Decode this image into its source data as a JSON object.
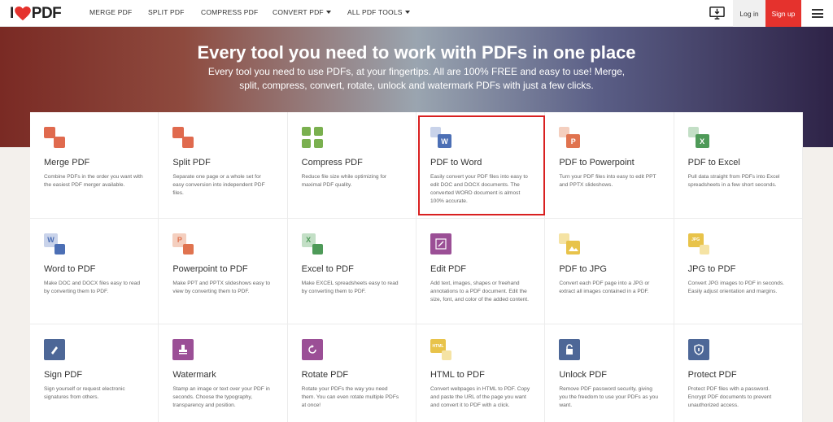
{
  "brand": {
    "logo_i": "I",
    "logo_pdf": "PDF",
    "accent": "#e5322d"
  },
  "nav": {
    "links": [
      {
        "label": "MERGE PDF",
        "dropdown": false
      },
      {
        "label": "SPLIT PDF",
        "dropdown": false
      },
      {
        "label": "COMPRESS PDF",
        "dropdown": false
      },
      {
        "label": "CONVERT PDF",
        "dropdown": true
      },
      {
        "label": "ALL PDF TOOLS",
        "dropdown": true
      }
    ],
    "login": "Log in",
    "signup": "Sign up"
  },
  "hero": {
    "title": "Every tool you need to work with PDFs in one place",
    "subtitle": "Every tool you need to use PDFs, at your fingertips. All are 100% FREE and easy to use! Merge, split, compress, convert, rotate, unlock and watermark PDFs with just a few clicks."
  },
  "tools": [
    {
      "name": "Merge PDF",
      "desc": "Combine PDFs in the order you want with the easiest PDF merger available.",
      "icon": "merge-icon",
      "color": "#e06a4e"
    },
    {
      "name": "Split PDF",
      "desc": "Separate one page or a whole set for easy conversion into independent PDF files.",
      "icon": "split-icon",
      "color": "#e06a4e"
    },
    {
      "name": "Compress PDF",
      "desc": "Reduce file size while optimizing for maximal PDF quality.",
      "icon": "compress-icon",
      "color": "#7ab04f"
    },
    {
      "name": "PDF to Word",
      "desc": "Easily convert your PDF files into easy to edit DOC and DOCX documents. The converted WORD document is almost 100% accurate.",
      "icon": "pdf-to-word-icon",
      "color": "#4c6fb5",
      "glyph": "W"
    },
    {
      "name": "PDF to Powerpoint",
      "desc": "Turn your PDF files into easy to edit PPT and PPTX slideshows.",
      "icon": "pdf-to-powerpoint-icon",
      "color": "#e0734f",
      "glyph": "P"
    },
    {
      "name": "PDF to Excel",
      "desc": "Pull data straight from PDFs into Excel spreadsheets in a few short seconds.",
      "icon": "pdf-to-excel-icon",
      "color": "#4e9a58",
      "glyph": "X"
    },
    {
      "name": "Word to PDF",
      "desc": "Make DOC and DOCX files easy to read by converting them to PDF.",
      "icon": "word-to-pdf-icon",
      "color": "#4c6fb5",
      "glyph": "W"
    },
    {
      "name": "Powerpoint to PDF",
      "desc": "Make PPT and PPTX slideshows easy to view by converting them to PDF.",
      "icon": "powerpoint-to-pdf-icon",
      "color": "#e0734f",
      "glyph": "P"
    },
    {
      "name": "Excel to PDF",
      "desc": "Make EXCEL spreadsheets easy to read by converting them to PDF.",
      "icon": "excel-to-pdf-icon",
      "color": "#4e9a58",
      "glyph": "X"
    },
    {
      "name": "Edit PDF",
      "desc": "Add text, images, shapes or freehand annotations to a PDF document. Edit the size, font, and color of the added content.",
      "icon": "edit-icon",
      "color": "#9b4f96"
    },
    {
      "name": "PDF to JPG",
      "desc": "Convert each PDF page into a JPG or extract all images contained in a PDF.",
      "icon": "pdf-to-jpg-icon",
      "color": "#e8c34a"
    },
    {
      "name": "JPG to PDF",
      "desc": "Convert JPG images to PDF in seconds. Easily adjust orientation and margins.",
      "icon": "jpg-to-pdf-icon",
      "color": "#e8c34a",
      "glyph": "JPG"
    },
    {
      "name": "Sign PDF",
      "desc": "Sign yourself or request electronic signatures from others.",
      "icon": "sign-icon",
      "color": "#4d6797"
    },
    {
      "name": "Watermark",
      "desc": "Stamp an image or text over your PDF in seconds. Choose the typography, transparency and position.",
      "icon": "watermark-icon",
      "color": "#9b4f96"
    },
    {
      "name": "Rotate PDF",
      "desc": "Rotate your PDFs the way you need them. You can even rotate multiple PDFs at once!",
      "icon": "rotate-icon",
      "color": "#9b4f96"
    },
    {
      "name": "HTML to PDF",
      "desc": "Convert webpages in HTML to PDF. Copy and paste the URL of the page you want and convert it to PDF with a click.",
      "icon": "html-to-pdf-icon",
      "color": "#e8c34a",
      "glyph": "HTML"
    },
    {
      "name": "Unlock PDF",
      "desc": "Remove PDF password security, giving you the freedom to use your PDFs as you want.",
      "icon": "unlock-icon",
      "color": "#4d6797"
    },
    {
      "name": "Protect PDF",
      "desc": "Protect PDF files with a password. Encrypt PDF documents to prevent unauthorized access.",
      "icon": "protect-icon",
      "color": "#4d6797"
    }
  ]
}
